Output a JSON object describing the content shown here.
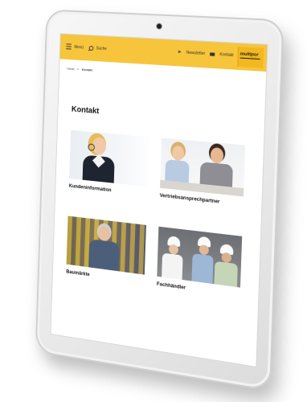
{
  "header": {
    "menu_label": "Menü",
    "search_label": "Suche",
    "newsletter_label": "Newsletter",
    "contact_label": "Kontakt",
    "logo_text": "multipor"
  },
  "breadcrumb": {
    "home": "Home",
    "separator": "»",
    "current": "Kontakt"
  },
  "page": {
    "title": "Kontakt"
  },
  "tiles": [
    {
      "caption": "Kundeninformation"
    },
    {
      "caption": "Vertriebsansprechpartner"
    },
    {
      "caption": "Baumärkte"
    },
    {
      "caption": "Fachhändler"
    }
  ],
  "colors": {
    "header_bar": "#f6c53c",
    "logo_bg": "#f3b71f",
    "text": "#111111"
  }
}
